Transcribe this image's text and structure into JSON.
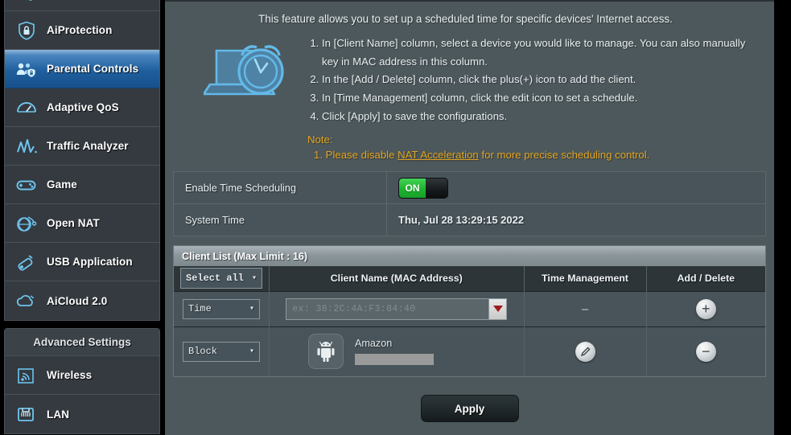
{
  "sidebar": {
    "items": [
      {
        "label": "",
        "icon": "network-map-icon",
        "partial": true,
        "active": false
      },
      {
        "label": "AiProtection",
        "icon": "shield-lock-icon",
        "partial": false,
        "active": false
      },
      {
        "label": "Parental Controls",
        "icon": "family-lock-icon",
        "partial": false,
        "active": true
      },
      {
        "label": "Adaptive QoS",
        "icon": "gauge-icon",
        "partial": false,
        "active": false
      },
      {
        "label": "Traffic Analyzer",
        "icon": "chart-wave-icon",
        "partial": false,
        "active": false
      },
      {
        "label": "Game",
        "icon": "gamepad-icon",
        "partial": false,
        "active": false
      },
      {
        "label": "Open NAT",
        "icon": "globe-gamepad-icon",
        "partial": false,
        "active": false
      },
      {
        "label": "USB Application",
        "icon": "usb-drive-icon",
        "partial": false,
        "active": false
      },
      {
        "label": "AiCloud 2.0",
        "icon": "cloud-icon",
        "partial": false,
        "active": false
      }
    ],
    "advanced": {
      "title": "Advanced Settings",
      "items": [
        {
          "label": "Wireless",
          "icon": "wifi-signal-icon"
        },
        {
          "label": "LAN",
          "icon": "ethernet-port-icon"
        }
      ]
    }
  },
  "intro": {
    "lead": "This feature allows you to set up a scheduled time for specific devices' Internet access.",
    "illustration_icon": "laptop-alarm-clock-icon",
    "steps": [
      "In [Client Name] column, select a device you would like to manage. You can also manually key in MAC address in this column.",
      "In the [Add / Delete] column, click the plus(+) icon to add the client.",
      "In [Time Management] column, click the edit icon to set a schedule.",
      "Click [Apply] to save the configurations."
    ],
    "note_title": "Note:",
    "note_number": "1.",
    "note_before": " Please disable ",
    "note_link": "NAT Acceleration",
    "note_after": " for more precise scheduling control."
  },
  "settings": {
    "enable_label": "Enable Time Scheduling",
    "enable_state": "ON",
    "system_time_label": "System Time",
    "system_time_value": "Thu, Jul 28 13:29:15 2022"
  },
  "client_list": {
    "header": "Client List (Max Limit : 16)",
    "columns": {
      "select_all": "Select all",
      "client_name": "Client Name (MAC Address)",
      "time_management": "Time Management",
      "add_delete": "Add / Delete"
    },
    "rows": [
      {
        "mode": "Time",
        "mac_placeholder": "ex: 38:2C:4A:F3:84:40",
        "time_management": "–",
        "action_icon": "plus-circle-icon",
        "type": "new"
      },
      {
        "mode": "Block",
        "client_name": "Amazon",
        "device_icon": "android-robot-icon",
        "mac_redacted": true,
        "edit_icon": "pencil-circle-icon",
        "action_icon": "minus-circle-icon",
        "type": "client"
      }
    ]
  },
  "footer": {
    "apply_label": "Apply"
  },
  "colors": {
    "accent_blue": "#4fb3e8",
    "panel_bg": "#4d585c",
    "note_amber": "#e3a51e",
    "toggle_on_green": "#1eb42f",
    "active_nav": "#1f5f9e"
  }
}
